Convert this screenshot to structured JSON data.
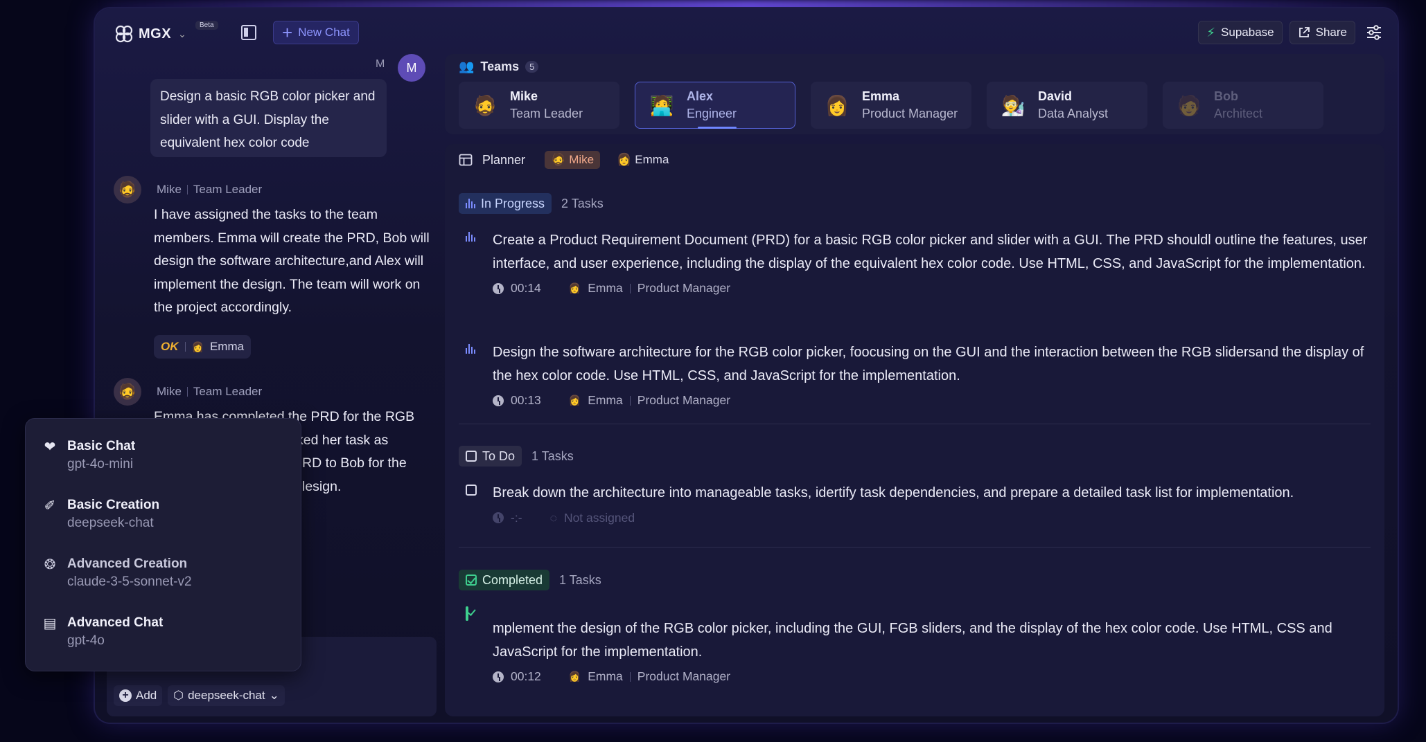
{
  "app": {
    "name": "MGX",
    "badge": "Beta",
    "new_chat_label": "New Chat",
    "supabase_label": "Supabase",
    "share_label": "Share"
  },
  "chat": {
    "user_initial": "M",
    "user_label": "M",
    "user_message": "Design a basic RGB color picker and slider with a GUI. Display the equivalent hex color code",
    "messages": [
      {
        "name": "Mike",
        "role": "Team Leader",
        "text": "I have assigned the tasks to the team members. Emma will create the PRD, Bob will design the software architecture,and Alex will implement the design. The team will work on the project accordingly.",
        "chip_ok": "OK",
        "chip_name": "Emma"
      },
      {
        "name": "Mike",
        "role": "Team Leader",
        "line1": "Emma has completed the PRD for the RGB",
        "line2": "ked her task as",
        "line3": "RD to Bob for the",
        "line4": "lesign."
      }
    ],
    "add_label": "Add",
    "model_label": "deepseek-chat"
  },
  "model_menu": [
    {
      "title": "Basic Chat",
      "model": "gpt-4o-mini",
      "icon": "heart-icon"
    },
    {
      "title": "Basic Creation",
      "model": "deepseek-chat",
      "icon": "brush-icon"
    },
    {
      "title": "Advanced Creation",
      "model": "claude-3-5-sonnet-v2",
      "icon": "brain-icon"
    },
    {
      "title": "Advanced Chat",
      "model": "gpt-4o",
      "icon": "chat-card-icon"
    }
  ],
  "teams": {
    "label": "Teams",
    "count": "5",
    "members": [
      {
        "name": "Mike",
        "role": "Team Leader",
        "avatar": "🧔"
      },
      {
        "name": "Alex",
        "role": "Engineer",
        "avatar": "🧑‍💻"
      },
      {
        "name": "Emma",
        "role": "Product Manager",
        "avatar": "👩"
      },
      {
        "name": "David",
        "role": "Data Analyst",
        "avatar": "🧑‍🔬"
      },
      {
        "name": "Bob",
        "role": "Architect",
        "avatar": "🧑"
      }
    ]
  },
  "planner": {
    "label": "Planner",
    "chip_mike": "Mike",
    "chip_emma": "Emma",
    "in_progress": {
      "label": "In Progress",
      "count": "2 Tasks",
      "tasks": [
        {
          "text": "Create a Product Requirement Document (PRD) for a basic RGB color picker and slider with a GUI. The PRD shouldl outline the features, user interface, and user experience, including the display of the equivalent hex color code. Use HTML, CSS, and JavaScript for the implementation.",
          "time": "00:14",
          "assignee": "Emma",
          "role": "Product Manager"
        },
        {
          "text": "Design the software architecture for the RGB color picker, foocusing on the GUI and the interaction between the RGB slidersand the display of the hex color code. Use HTML, CSS, and JavaScript for the implementation.",
          "time": "00:13",
          "assignee": "Emma",
          "role": "Product Manager"
        }
      ]
    },
    "todo": {
      "label": "To Do",
      "count": "1 Tasks",
      "tasks": [
        {
          "text": "Break down the architecture into manageable tasks, idertify task dependencies, and prepare a detailed task list for implementation.",
          "time": "-:-",
          "assignee": "Not assigned"
        }
      ]
    },
    "completed": {
      "label": "Completed",
      "count": "1 Tasks",
      "tasks": [
        {
          "text": "mplement the design of the RGB color picker, including the GUI, FGB sliders, and the display of the hex color code. Use HTML, CSS and JavaScript for the implementation.",
          "time": "00:12",
          "assignee": "Emma",
          "role": "Product Manager"
        }
      ]
    }
  },
  "colors": {
    "accent": "#8e96ff",
    "supabase": "#3ecf8e",
    "ok": "#f0b030"
  }
}
